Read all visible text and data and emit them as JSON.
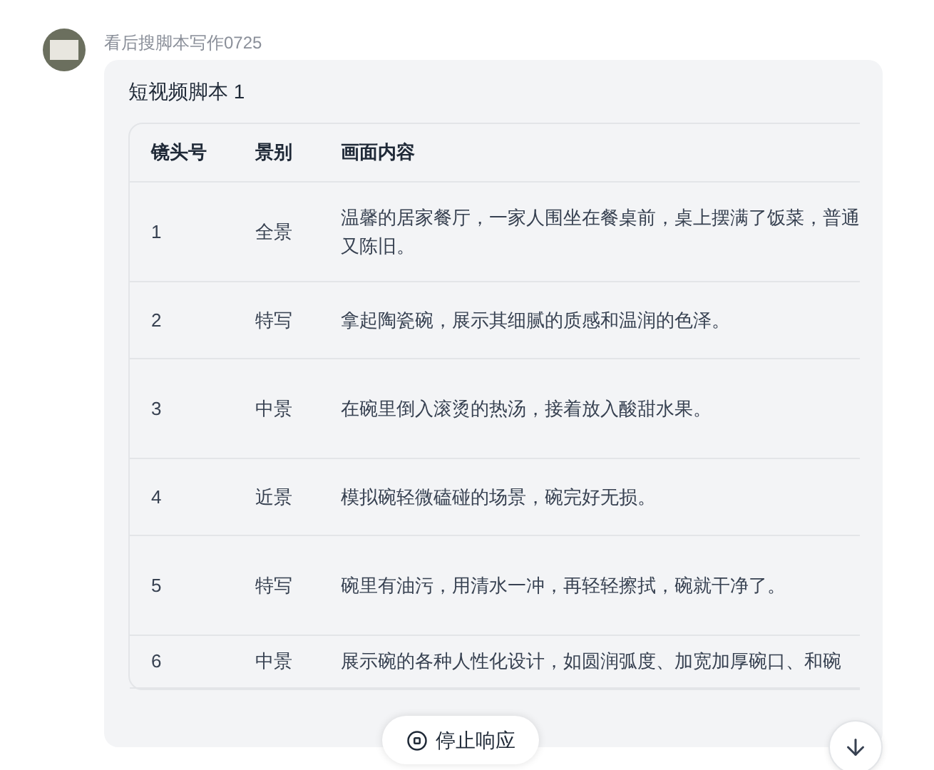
{
  "sender": {
    "name": "看后搜脚本写作0725"
  },
  "message": {
    "title": "短视频脚本 1",
    "table": {
      "columns": [
        "镜头号",
        "景别",
        "画面内容"
      ],
      "rows": [
        {
          "shot": "1",
          "framing": "全景",
          "content": "温馨的居家餐厅，一家人围坐在餐桌前，桌上摆满了饭菜，普通又陈旧。"
        },
        {
          "shot": "2",
          "framing": "特写",
          "content": "拿起陶瓷碗，展示其细腻的质感和温润的色泽。"
        },
        {
          "shot": "3",
          "framing": "中景",
          "content": "在碗里倒入滚烫的热汤，接着放入酸甜水果。"
        },
        {
          "shot": "4",
          "framing": "近景",
          "content": "模拟碗轻微磕碰的场景，碗完好无损。"
        },
        {
          "shot": "5",
          "framing": "特写",
          "content": "碗里有油污，用清水一冲，再轻轻擦拭，碗就干净了。"
        },
        {
          "shot": "6",
          "framing": "中景",
          "content": "展示碗的各种人性化设计，如圆润弧度、加宽加厚碗口、和碗"
        }
      ]
    }
  },
  "stop_button": {
    "label": "停止响应"
  }
}
